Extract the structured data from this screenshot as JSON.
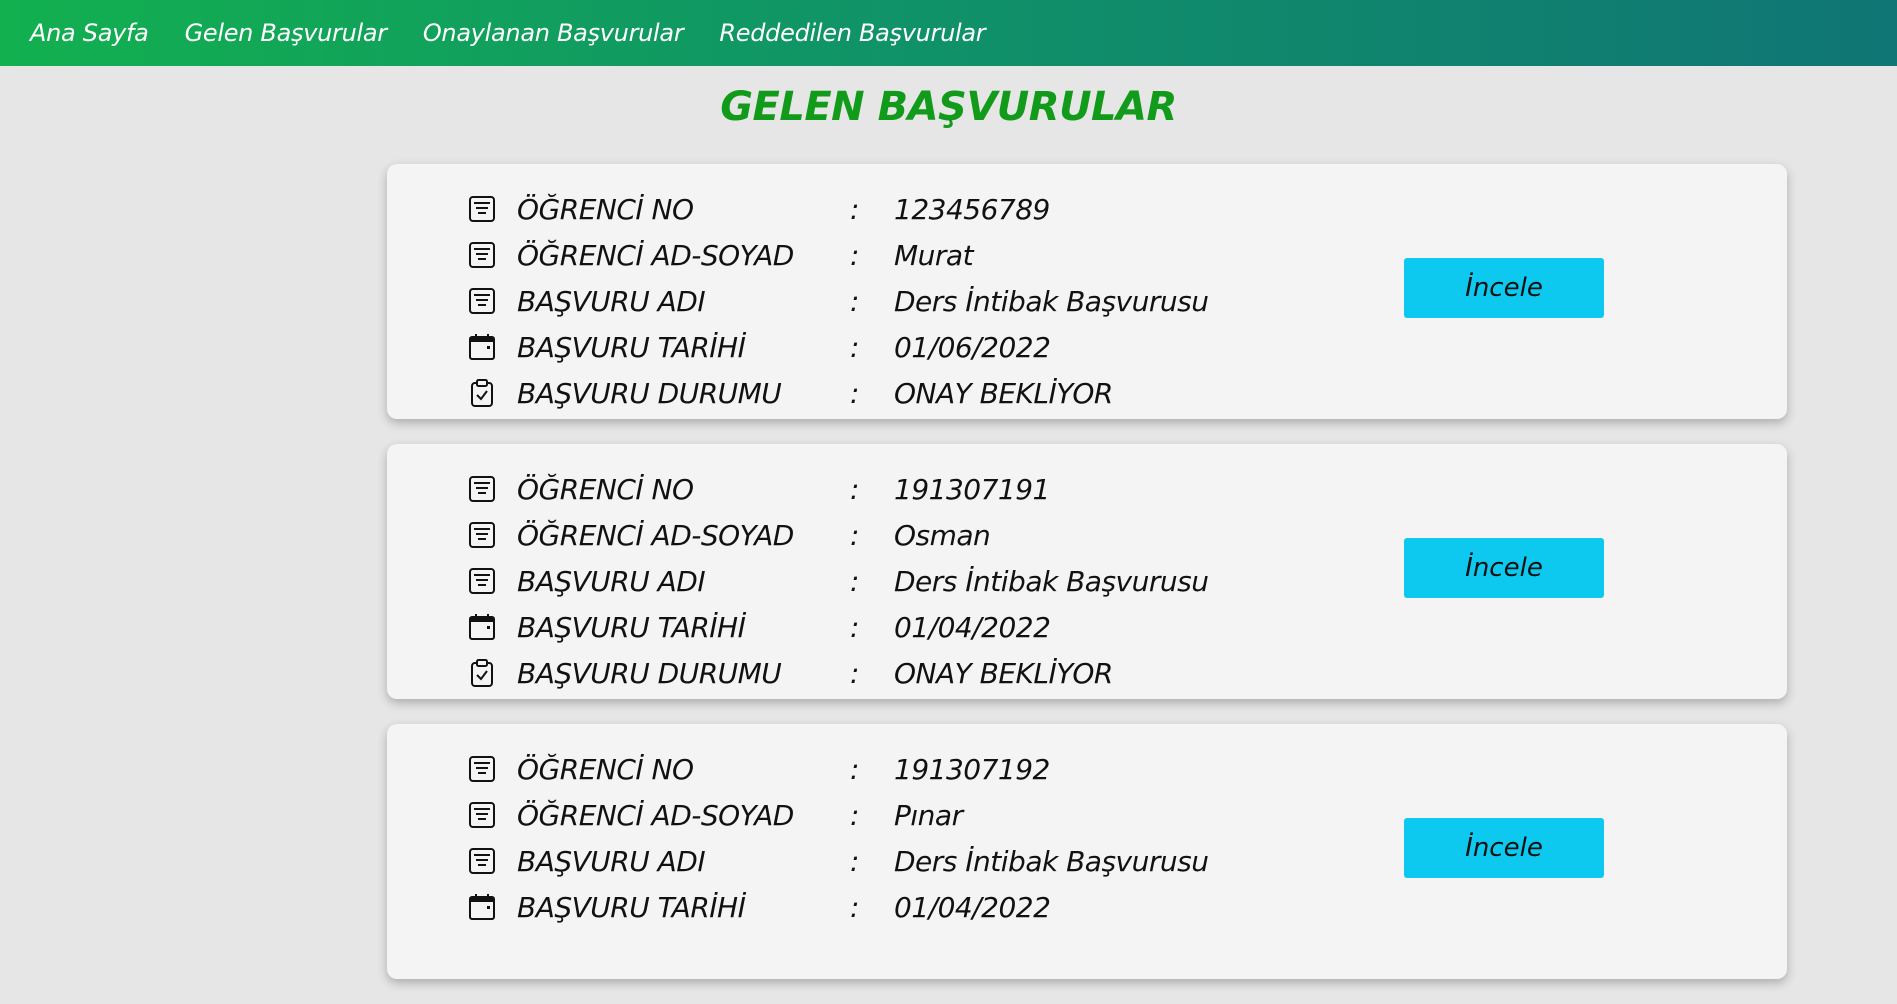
{
  "nav": {
    "items": [
      {
        "label": "Ana Sayfa"
      },
      {
        "label": "Gelen Başvurular"
      },
      {
        "label": "Onaylanan Başvurular"
      },
      {
        "label": "Reddedilen Başvurular"
      }
    ]
  },
  "page_title": "GELEN BAŞVURULAR",
  "labels": {
    "student_no": "ÖĞRENCİ NO",
    "student_name": "ÖĞRENCİ AD-SOYAD",
    "application_name": "BAŞVURU ADI",
    "application_date": "BAŞVURU TARİHİ",
    "application_status": "BAŞVURU DURUMU",
    "separator": ":",
    "review_button": "İncele"
  },
  "applications": [
    {
      "student_no": "123456789",
      "student_name": "Murat",
      "application_name": "Ders İntibak Başvurusu",
      "application_date": "01/06/2022",
      "application_status": "ONAY BEKLİYOR"
    },
    {
      "student_no": "191307191",
      "student_name": "Osman",
      "application_name": "Ders İntibak Başvurusu",
      "application_date": "01/04/2022",
      "application_status": "ONAY BEKLİYOR"
    },
    {
      "student_no": "191307192",
      "student_name": "Pınar",
      "application_name": "Ders İntibak Başvurusu",
      "application_date": "01/04/2022",
      "application_status": ""
    }
  ],
  "icons": {
    "field": "list-document-icon",
    "date": "calendar-icon",
    "status": "clipboard-check-icon"
  },
  "colors": {
    "nav_gradient_start": "#12b04f",
    "nav_gradient_end": "#107575",
    "title": "#129a1a",
    "button": "#0ec9ef",
    "card_bg": "#f4f4f4",
    "page_bg": "#e6e6e6"
  }
}
